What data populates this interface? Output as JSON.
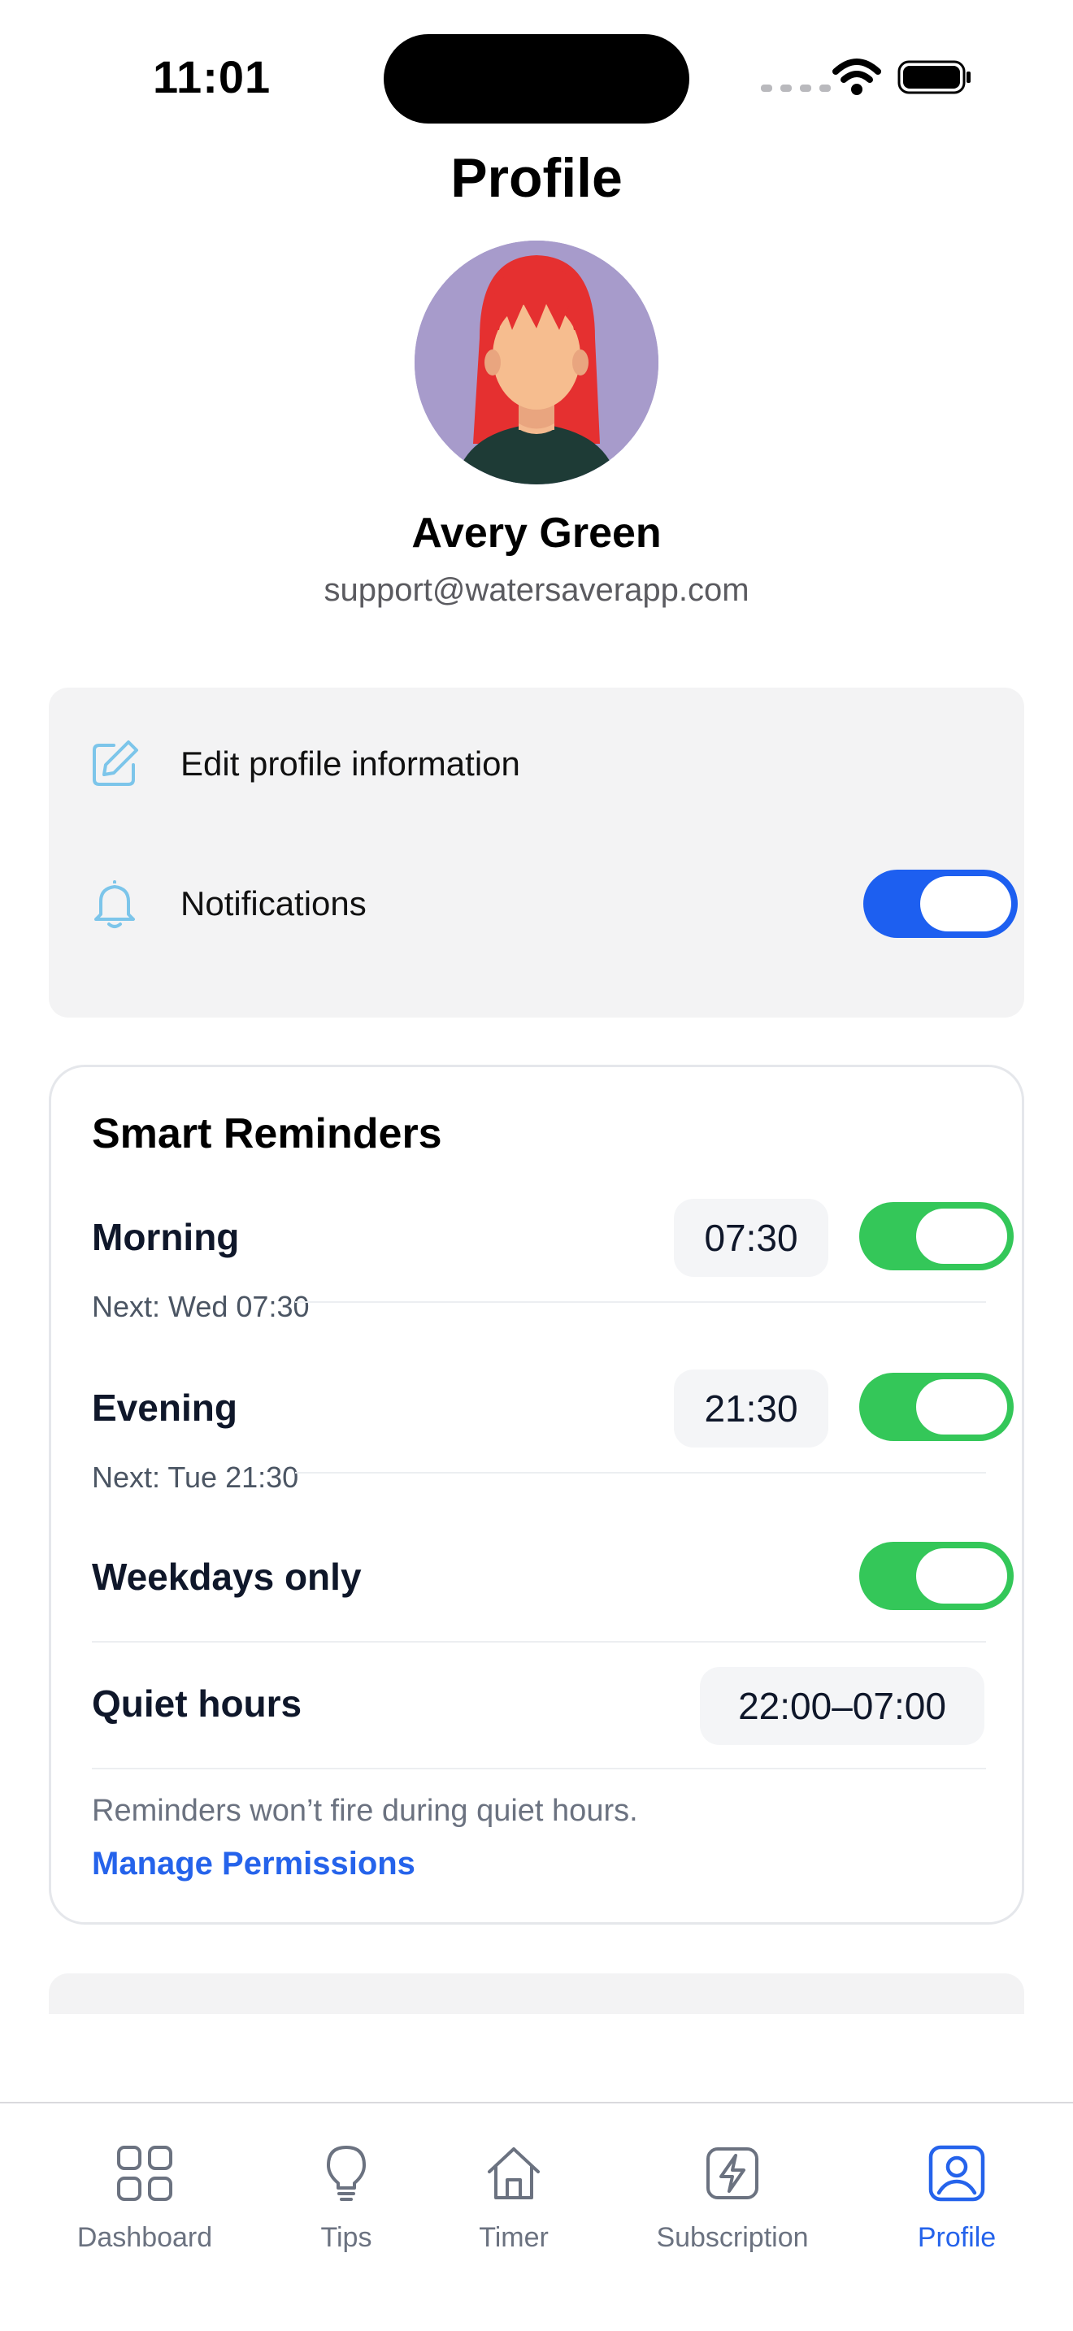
{
  "status_bar": {
    "time": "11:01"
  },
  "header": {
    "title": "Profile"
  },
  "user": {
    "name": "Avery Green",
    "email": "support@watersaverapp.com"
  },
  "settings": {
    "edit_label": "Edit profile information",
    "notifications_label": "Notifications",
    "notifications_enabled": true
  },
  "reminders": {
    "title": "Smart Reminders",
    "morning": {
      "label": "Morning",
      "time": "07:30",
      "next": "Next: Wed 07:30",
      "enabled": true
    },
    "evening": {
      "label": "Evening",
      "time": "21:30",
      "next": "Next: Tue 21:30",
      "enabled": true
    },
    "weekdays": {
      "label": "Weekdays only",
      "enabled": true
    },
    "quiet": {
      "label": "Quiet hours",
      "value": "22:00–07:00"
    },
    "note": "Reminders won’t fire during quiet hours.",
    "link": "Manage Permissions"
  },
  "tabs": [
    {
      "label": "Dashboard",
      "icon": "grid-icon",
      "active": false
    },
    {
      "label": "Tips",
      "icon": "lightbulb-icon",
      "active": false
    },
    {
      "label": "Timer",
      "icon": "home-icon",
      "active": false
    },
    {
      "label": "Subscription",
      "icon": "bolt-icon",
      "active": false
    },
    {
      "label": "Profile",
      "icon": "profile-icon",
      "active": true
    }
  ],
  "colors": {
    "accent": "#2563eb",
    "toggle_blue": "#1d5ff0",
    "toggle_green": "#34c759",
    "icon_light_blue": "#7cc5ea"
  }
}
